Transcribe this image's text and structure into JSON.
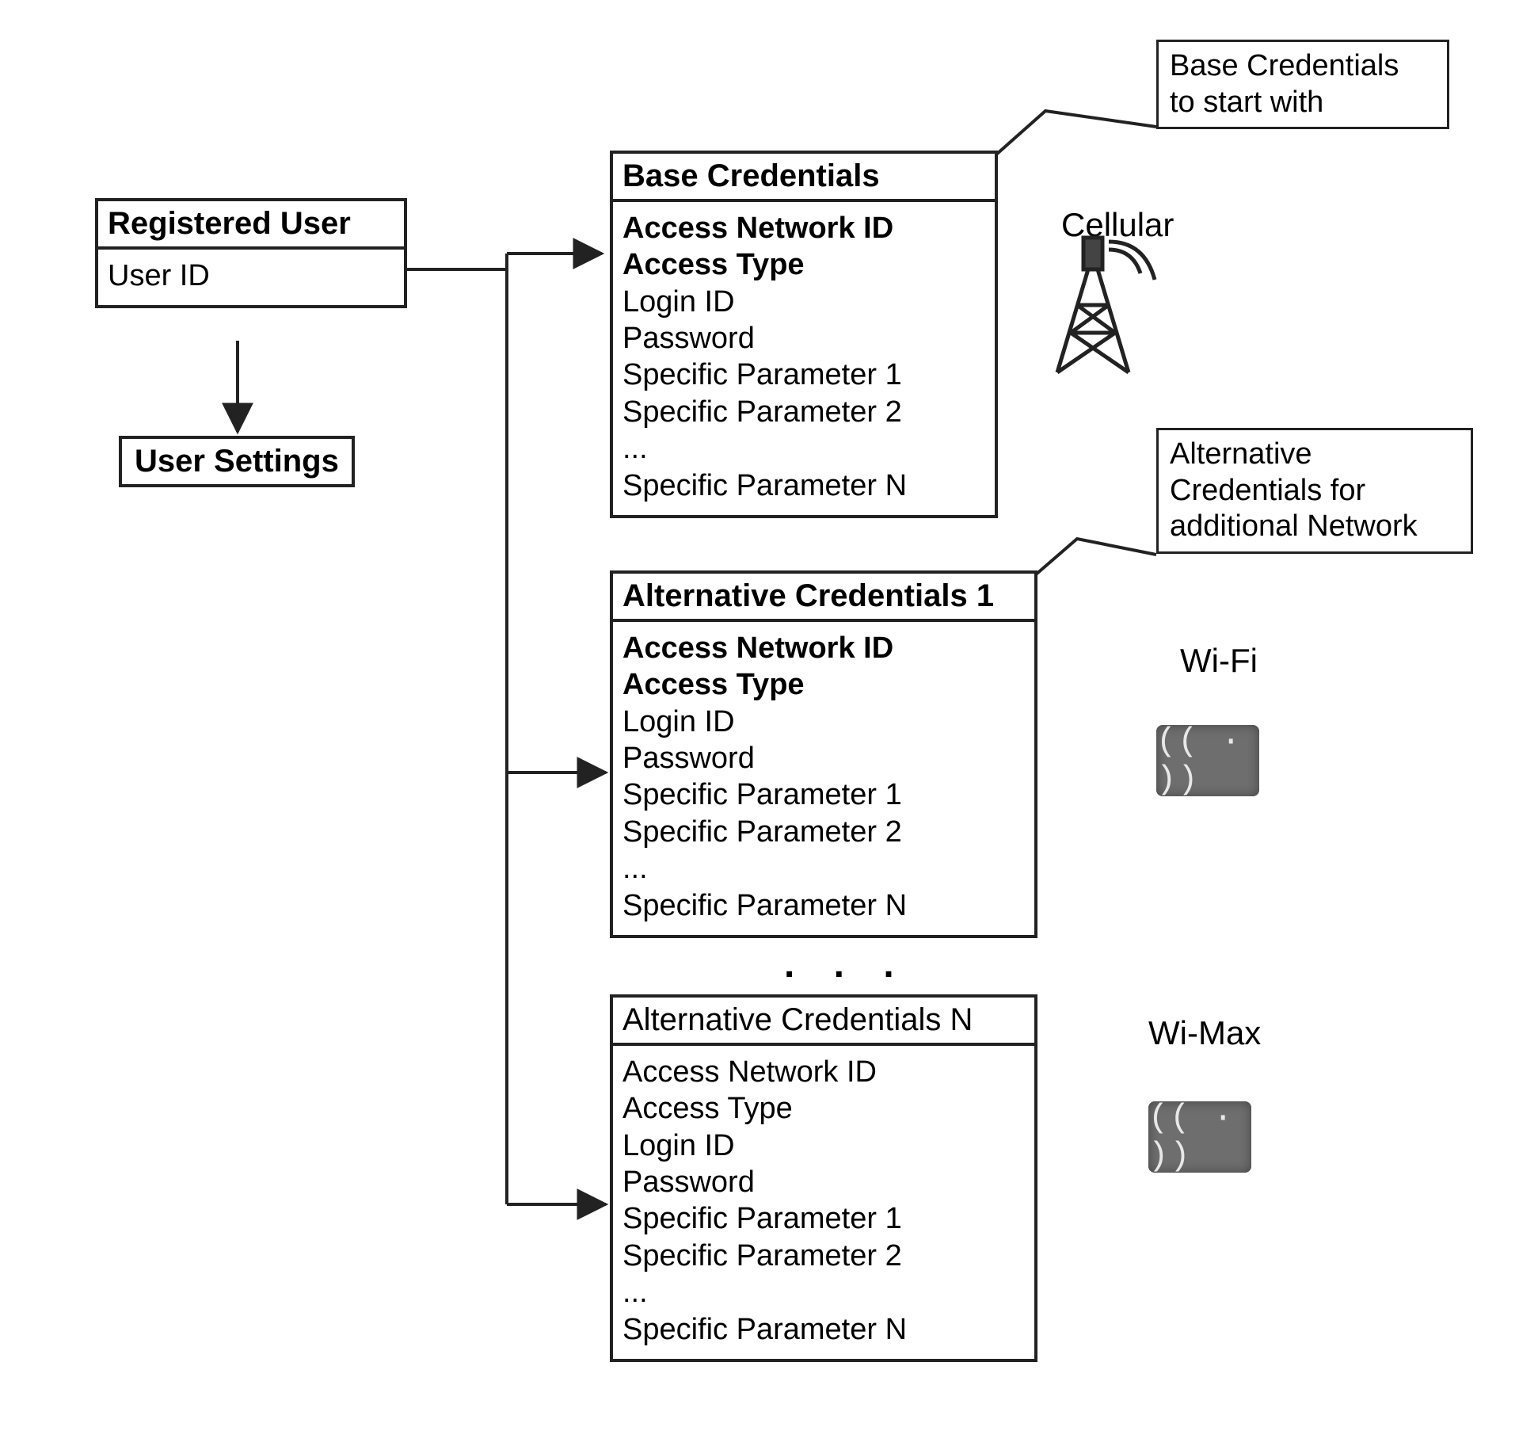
{
  "registered_user": {
    "title": "Registered User",
    "field": "User ID"
  },
  "user_settings": {
    "label": "User Settings"
  },
  "annot_base": {
    "line1": "Base Credentials",
    "line2": "to start with"
  },
  "annot_alt": {
    "line1": "Alternative",
    "line2": "Credentials for",
    "line3": "additional Network"
  },
  "base_cred": {
    "title": "Base Credentials",
    "bold1": "Access Network ID",
    "bold2": "Access Type",
    "row_login": "Login ID",
    "row_pass": "Password",
    "row_p1": "Specific Parameter 1",
    "row_p2": "Specific Parameter 2",
    "row_dots": "...",
    "row_pn": "Specific Parameter N"
  },
  "alt1": {
    "title": "Alternative Credentials 1",
    "bold1": "Access Network ID",
    "bold2": "Access Type",
    "row_login": "Login ID",
    "row_pass": "Password",
    "row_p1": "Specific Parameter 1",
    "row_p2": "Specific Parameter 2",
    "row_dots": "...",
    "row_pn": "Specific Parameter N"
  },
  "altn": {
    "title": "Alternative Credentials N",
    "row1": "Access Network ID",
    "row2": "Access Type",
    "row_login": "Login ID",
    "row_pass": "Password",
    "row_p1": "Specific Parameter 1",
    "row_p2": "Specific Parameter 2",
    "row_dots": "...",
    "row_pn": "Specific Parameter N"
  },
  "networks": {
    "cellular": "Cellular",
    "wifi": "Wi-Fi",
    "wimax": "Wi-Max"
  },
  "between_dots": ". . ."
}
